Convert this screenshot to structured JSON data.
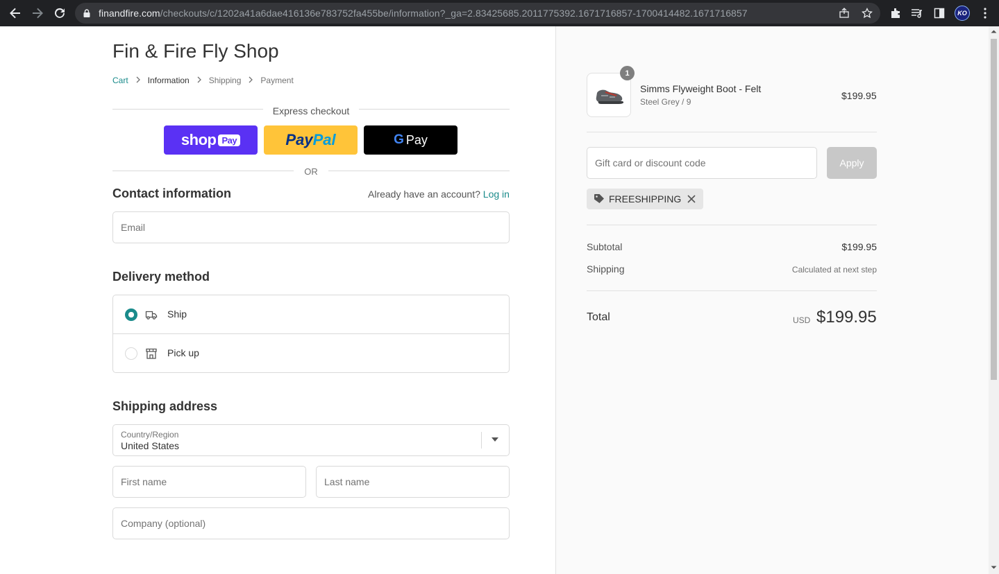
{
  "browser": {
    "url_host": "finandfire.com",
    "url_path": "/checkouts/c/1202a41a6dae416136e783752fa455be/information?_ga=2.83425685.2011775392.1671716857-1700414482.1671716857",
    "profile_initials": "KO"
  },
  "shop": {
    "title": "Fin & Fire Fly Shop"
  },
  "breadcrumb": {
    "cart": "Cart",
    "information": "Information",
    "shipping": "Shipping",
    "payment": "Payment"
  },
  "express": {
    "label": "Express checkout",
    "shop_pay_text": "shop",
    "shop_pay_pill": "Pay",
    "paypal_part1": "Pay",
    "paypal_part2": "Pal",
    "gpay_g": "G",
    "gpay_text": "Pay",
    "or_label": "OR"
  },
  "contact": {
    "title": "Contact information",
    "account_prompt": "Already have an account?",
    "login_link": "Log in",
    "email_placeholder": "Email"
  },
  "delivery": {
    "title": "Delivery method",
    "options": [
      {
        "label": "Ship",
        "selected": true
      },
      {
        "label": "Pick up",
        "selected": false
      }
    ]
  },
  "shipping_address": {
    "title": "Shipping address",
    "country_label": "Country/Region",
    "country_value": "United States",
    "first_name_placeholder": "First name",
    "last_name_placeholder": "Last name",
    "company_placeholder": "Company (optional)"
  },
  "order": {
    "item": {
      "name": "Simms Flyweight Boot - Felt",
      "variant": "Steel Grey / 9",
      "price": "$199.95",
      "quantity": "1"
    },
    "discount_placeholder": "Gift card or discount code",
    "apply_label": "Apply",
    "applied_code": "FREESHIPPING",
    "subtotal_label": "Subtotal",
    "subtotal_value": "$199.95",
    "shipping_label": "Shipping",
    "shipping_value": "Calculated at next step",
    "total_label": "Total",
    "total_currency": "USD",
    "total_value": "$199.95"
  },
  "colors": {
    "accent": "#1a8b8b",
    "shop_pay": "#5a31f4",
    "paypal": "#ffc439",
    "gpay": "#000000"
  }
}
